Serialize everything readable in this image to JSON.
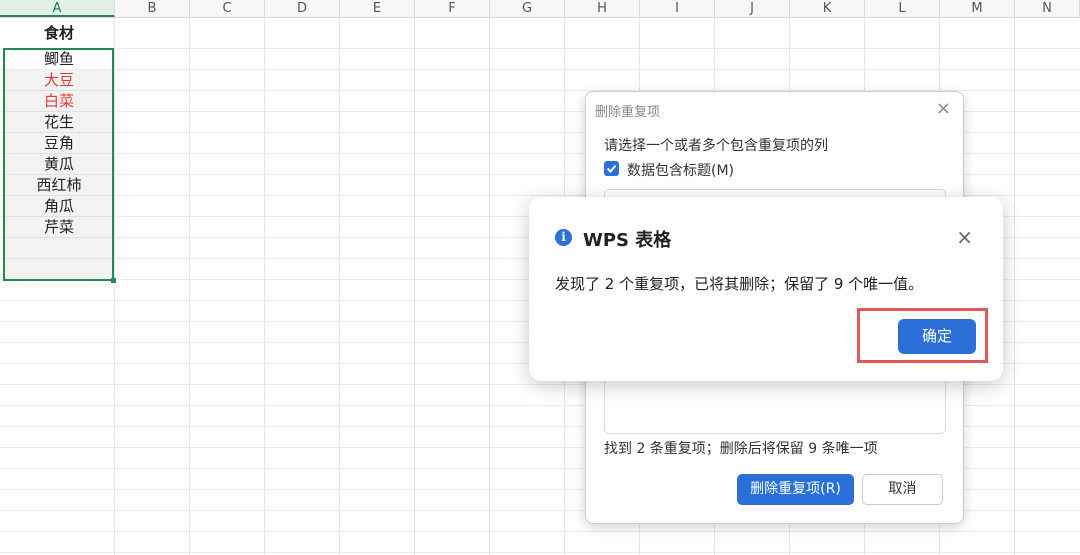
{
  "columns": [
    "A",
    "B",
    "C",
    "D",
    "E",
    "F",
    "G",
    "H",
    "I",
    "J",
    "K",
    "L",
    "M",
    "N"
  ],
  "cells": {
    "header": "食材",
    "items": [
      {
        "text": "鲫鱼",
        "color": "#222222"
      },
      {
        "text": "大豆",
        "color": "#e53935"
      },
      {
        "text": "白菜",
        "color": "#e53935"
      },
      {
        "text": "花生",
        "color": "#222222"
      },
      {
        "text": "豆角",
        "color": "#222222"
      },
      {
        "text": "黄瓜",
        "color": "#222222"
      },
      {
        "text": "西红柿",
        "color": "#222222"
      },
      {
        "text": "角瓜",
        "color": "#222222"
      },
      {
        "text": "芹菜",
        "color": "#222222"
      }
    ]
  },
  "remove_dialog": {
    "title": "删除重复项",
    "close": "×",
    "instruction": "请选择一个或者多个包含重复项的列",
    "checkbox_label": "数据包含标题(M)",
    "checkbox_checked": true,
    "found_text": "找到 2 条重复项；删除后将保留 9 条唯一项",
    "remove_button": "删除重复项(R)",
    "cancel_button": "取消"
  },
  "message_box": {
    "title": "WPS 表格",
    "icon": "info-icon",
    "close": "×",
    "text": "发现了 2 个重复项，已将其删除；保留了 9 个唯一值。",
    "ok_button": "确定"
  },
  "colors": {
    "accent": "#2b6fd8",
    "selection": "#1f8a54",
    "highlight": "#e0575c"
  }
}
